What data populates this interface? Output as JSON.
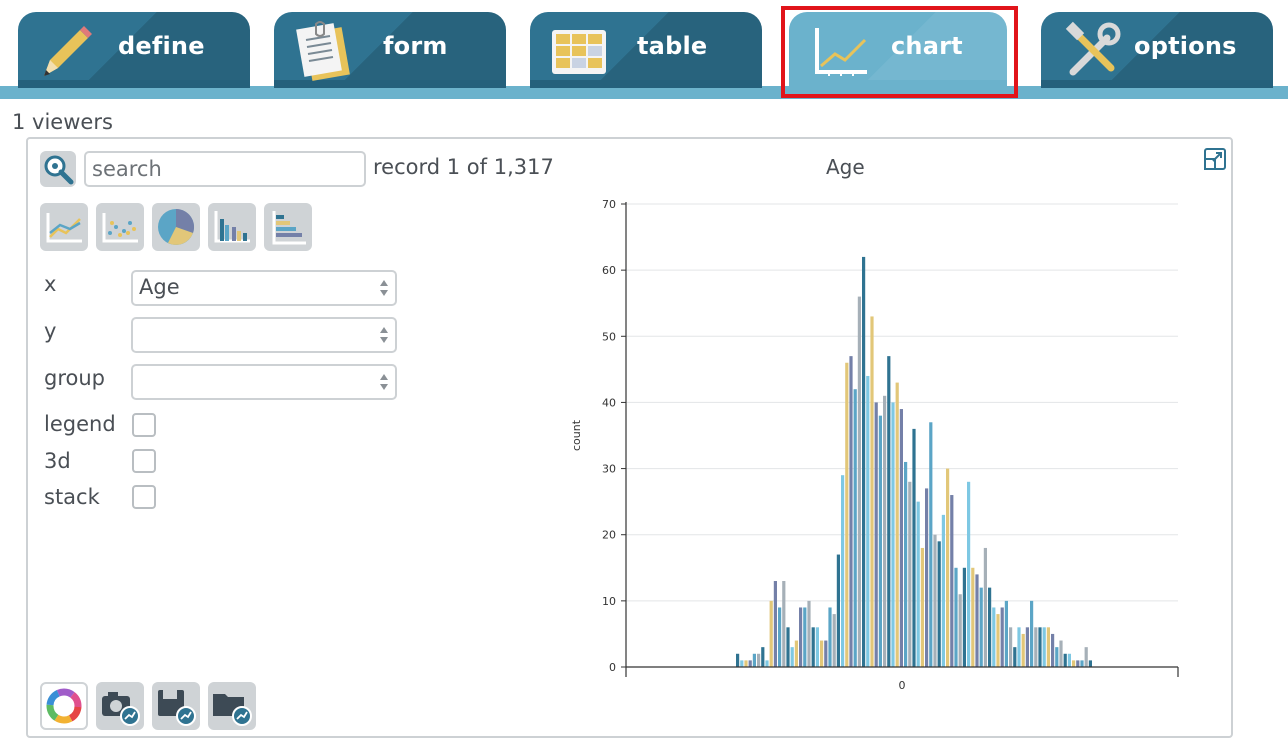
{
  "tabs": [
    {
      "id": "define",
      "label": "define",
      "icon": "pencil-icon",
      "active": false
    },
    {
      "id": "form",
      "label": "form",
      "icon": "form-notepad-icon",
      "active": false
    },
    {
      "id": "table",
      "label": "table",
      "icon": "table-grid-icon",
      "active": false
    },
    {
      "id": "chart",
      "label": "chart",
      "icon": "line-chart-icon",
      "active": true
    },
    {
      "id": "options",
      "label": "options",
      "icon": "tools-icon",
      "active": false
    }
  ],
  "viewers_label": "1 viewers",
  "search": {
    "placeholder": "search",
    "value": ""
  },
  "record_label": "record 1 of 1,317",
  "chart_type_buttons": [
    "line-chart-icon",
    "scatter-chart-icon",
    "pie-chart-icon",
    "bar-chart-icon",
    "horizontal-bar-chart-icon"
  ],
  "fields": {
    "x": {
      "label": "x",
      "value": "Age"
    },
    "y": {
      "label": "y",
      "value": ""
    },
    "group": {
      "label": "group",
      "value": ""
    },
    "legend": {
      "label": "legend",
      "checked": false
    },
    "threed": {
      "label": "3d",
      "checked": false
    },
    "stack": {
      "label": "stack",
      "checked": false
    }
  },
  "bottom_buttons": [
    "color-wheel-icon",
    "camera-chart-icon",
    "save-chart-icon",
    "open-chart-icon"
  ],
  "colors": {
    "tab": "#2f7391",
    "tab_active": "#6bb2cc",
    "highlight": "#e1141a",
    "series_palette": [
      "#2f7391",
      "#7ec8e3",
      "#e2c779",
      "#7480a8",
      "#5ba5c6",
      "#a6b0b8"
    ]
  },
  "chart_data": {
    "type": "bar",
    "title": "Age",
    "xlabel": "",
    "ylabel": "count",
    "x_tick_labels": [
      "0"
    ],
    "ylim": [
      0,
      70
    ],
    "yticks": [
      0,
      10,
      20,
      30,
      40,
      50,
      60,
      70
    ],
    "grid": true,
    "values": [
      2,
      1,
      1,
      1,
      2,
      2,
      3,
      1,
      10,
      13,
      9,
      13,
      6,
      3,
      4,
      9,
      9,
      10,
      6,
      6,
      4,
      4,
      9,
      8,
      17,
      29,
      46,
      47,
      42,
      56,
      62,
      44,
      53,
      40,
      38,
      41,
      47,
      40,
      43,
      39,
      31,
      28,
      36,
      25,
      18,
      27,
      37,
      20,
      19,
      23,
      30,
      26,
      15,
      11,
      15,
      28,
      15,
      14,
      12,
      18,
      12,
      9,
      8,
      9,
      10,
      6,
      3,
      6,
      5,
      6,
      10,
      6,
      6,
      6,
      6,
      5,
      3,
      4,
      2,
      2,
      1,
      1,
      1,
      3,
      1
    ]
  }
}
